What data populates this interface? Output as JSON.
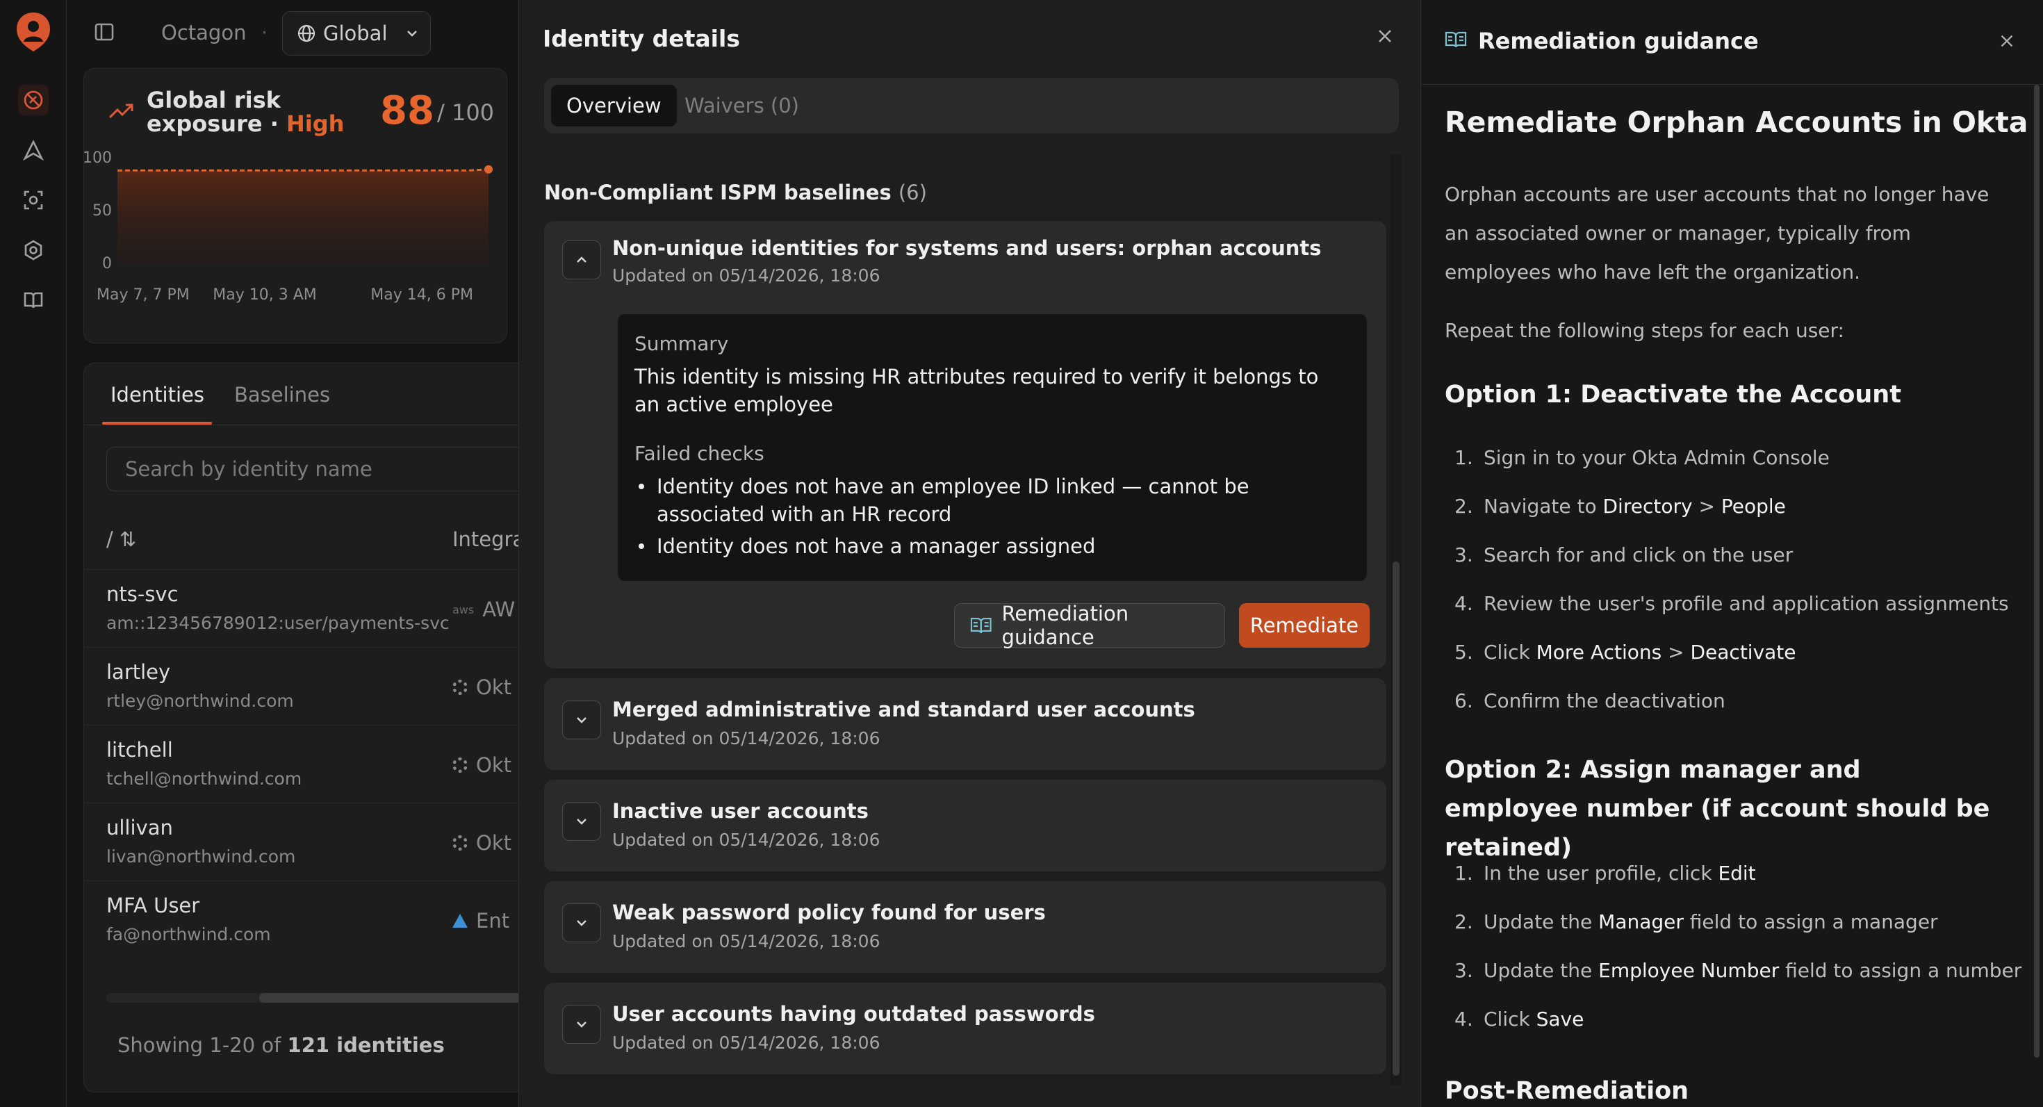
{
  "app": {
    "org": "Octagon",
    "scope": "Global"
  },
  "risk": {
    "title_line1": "Global risk",
    "title_line2": "exposure · ",
    "level": "High",
    "score": "88",
    "max": "/ 100"
  },
  "chart_data": {
    "type": "area",
    "title": "",
    "y_ticks": [
      "100",
      "50",
      "0"
    ],
    "x_ticks": [
      "May 7, 7 PM",
      "May 10, 3 AM",
      "May 14, 6 PM"
    ],
    "ylim": [
      0,
      100
    ],
    "series": [
      {
        "values": [
          88,
          88,
          88,
          88,
          88,
          88,
          88,
          88,
          88,
          88,
          88,
          88,
          88,
          88,
          88,
          88,
          88,
          88,
          88,
          89
        ]
      }
    ],
    "colors": {
      "line": "#e0662e"
    }
  },
  "identities": {
    "tabs": [
      "Identities",
      "Baselines"
    ],
    "search_placeholder": "Search by identity name",
    "col_sort": "/ ⇅",
    "col_integration": "Integra",
    "rows": [
      {
        "name": "nts-svc",
        "sub": "am::123456789012:user/payments-svc",
        "integration": "AW"
      },
      {
        "name": "lartley",
        "sub": "rtley@northwind.com",
        "integration": "Okt"
      },
      {
        "name": "litchell",
        "sub": "tchell@northwind.com",
        "integration": "Okt"
      },
      {
        "name": "ullivan",
        "sub": "livan@northwind.com",
        "integration": "Okt"
      },
      {
        "name": "MFA User",
        "sub": "fa@northwind.com",
        "integration": "Ent"
      }
    ],
    "showing_prefix": "Showing 1-20 of ",
    "showing_count": "121 identities"
  },
  "identity_panel": {
    "title": "Identity details",
    "tabs": [
      "Overview",
      "Waivers (0)"
    ],
    "section_title": "Non-Compliant ISPM baselines",
    "section_count": "(6)",
    "baselines": [
      {
        "title": "Non-unique identities for systems and users: orphan accounts",
        "updated": "Updated on 05/14/2026, 18:06",
        "summary_label": "Summary",
        "summary": "This identity is missing HR attributes required to verify it belongs to an active employee",
        "failed_label": "Failed checks",
        "failed": [
          "Identity does not have an employee ID linked — cannot be associated with an HR record",
          "Identity does not have a manager assigned"
        ],
        "guidance_button": "Remediation guidance",
        "remediate_button": "Remediate"
      },
      {
        "title": "Merged administrative and standard user accounts",
        "updated": "Updated on 05/14/2026, 18:06"
      },
      {
        "title": "Inactive user accounts",
        "updated": "Updated on 05/14/2026, 18:06"
      },
      {
        "title": "Weak password policy found for users",
        "updated": "Updated on 05/14/2026, 18:06"
      },
      {
        "title": "User accounts having outdated passwords",
        "updated": "Updated on 05/14/2026, 18:06"
      }
    ]
  },
  "guidance": {
    "header": "Remediation guidance",
    "title": "Remediate Orphan Accounts in Okta",
    "intro": "Orphan accounts are user accounts that no longer have an associated owner or manager, typically from employees who have left the organization.",
    "repeat": "Repeat the following steps for each user:",
    "option1_title": "Option 1: Deactivate the Account",
    "option1_steps": [
      {
        "n": "1.",
        "a": "Sign in to your Okta Admin Console",
        "b": "",
        "c": "",
        "d": ""
      },
      {
        "n": "2.",
        "a": "Navigate to ",
        "b": "Directory",
        "c": " > ",
        "d": "People"
      },
      {
        "n": "3.",
        "a": "Search for and click on the user",
        "b": "",
        "c": "",
        "d": ""
      },
      {
        "n": "4.",
        "a": "Review the user's profile and application assignments",
        "b": "",
        "c": "",
        "d": ""
      },
      {
        "n": "5.",
        "a": "Click ",
        "b": "More Actions",
        "c": " > ",
        "d": "Deactivate"
      },
      {
        "n": "6.",
        "a": "Confirm the deactivation",
        "b": "",
        "c": "",
        "d": ""
      }
    ],
    "option2_title": "Option 2: Assign manager and employee number (if account should be retained)",
    "option2_steps": [
      {
        "n": "1.",
        "a": "In the user profile, click ",
        "b": "Edit",
        "c": "",
        "d": ""
      },
      {
        "n": "2.",
        "a": "Update the ",
        "b": "Manager",
        "c": " field to assign a manager",
        "d": ""
      },
      {
        "n": "3.",
        "a": "Update the ",
        "b": "Employee Number",
        "c": " field to assign a number",
        "d": ""
      },
      {
        "n": "4.",
        "a": "Click ",
        "b": "Save",
        "c": "",
        "d": ""
      }
    ],
    "post_title": "Post-Remediation"
  }
}
